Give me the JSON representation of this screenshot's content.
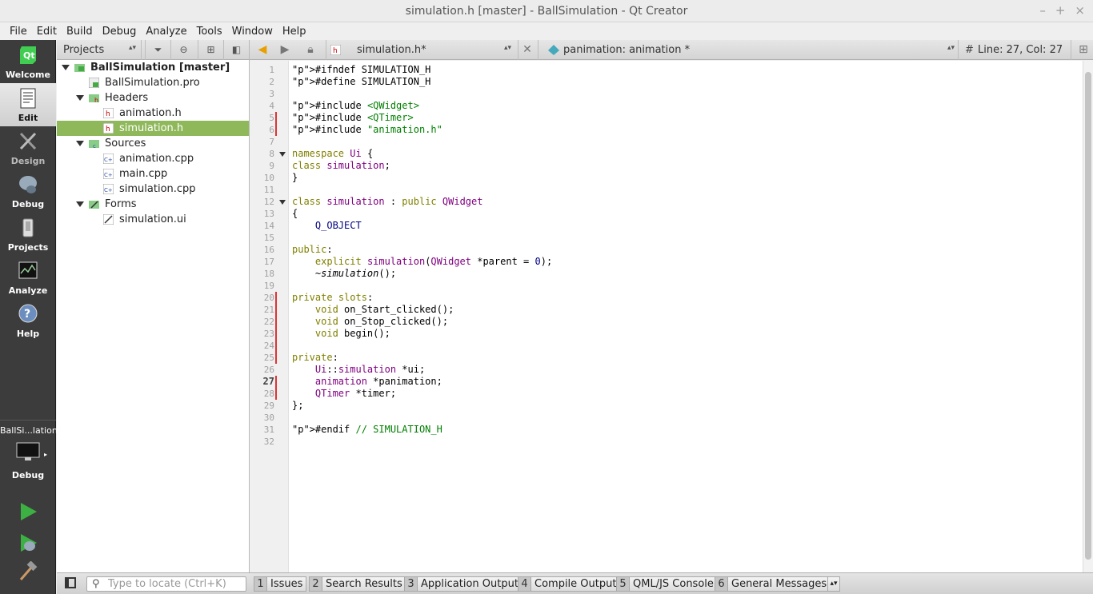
{
  "window": {
    "title": "simulation.h [master] - BallSimulation - Qt Creator",
    "controls": [
      "–",
      "+",
      "×"
    ]
  },
  "menu": [
    "File",
    "Edit",
    "Build",
    "Debug",
    "Analyze",
    "Tools",
    "Window",
    "Help"
  ],
  "modes": [
    {
      "label": "Welcome",
      "icon": "qt-logo-icon"
    },
    {
      "label": "Edit",
      "icon": "edit-document-icon"
    },
    {
      "label": "Design",
      "icon": "design-pen-icon"
    },
    {
      "label": "Debug",
      "icon": "debug-bug-icon"
    },
    {
      "label": "Projects",
      "icon": "projects-wrench-icon"
    },
    {
      "label": "Analyze",
      "icon": "analyze-chart-icon"
    },
    {
      "label": "Help",
      "icon": "help-question-icon"
    }
  ],
  "kit": {
    "name": "BallSi...lation",
    "build": "Debug"
  },
  "project_panel": {
    "combo_label": "Projects"
  },
  "tree": [
    {
      "label": "BallSimulation [master]",
      "bold": true,
      "type": "project"
    },
    {
      "label": "BallSimulation.pro",
      "type": "pro"
    },
    {
      "label": "Headers",
      "type": "folder-h"
    },
    {
      "label": "animation.h",
      "type": "h"
    },
    {
      "label": "simulation.h",
      "type": "h",
      "selected": true
    },
    {
      "label": "Sources",
      "type": "folder-cpp"
    },
    {
      "label": "animation.cpp",
      "type": "cpp"
    },
    {
      "label": "main.cpp",
      "type": "cpp"
    },
    {
      "label": "simulation.cpp",
      "type": "cpp"
    },
    {
      "label": "Forms",
      "type": "folder-ui"
    },
    {
      "label": "simulation.ui",
      "type": "ui"
    }
  ],
  "editor_toolbar": {
    "file": "simulation.h*",
    "symbol": "panimation: animation *",
    "position": "Line: 27, Col: 27"
  },
  "editor": {
    "current_line": 27,
    "changed_lines": [
      5,
      6,
      20,
      21,
      22,
      23,
      24,
      25,
      27,
      28
    ],
    "fold_lines": [
      8,
      12
    ],
    "lines": [
      "#ifndef SIMULATION_H",
      "#define SIMULATION_H",
      "",
      "#include <QWidget>",
      "#include <QTimer>",
      "#include \"animation.h\"",
      "",
      "namespace Ui {",
      "class simulation;",
      "}",
      "",
      "class simulation : public QWidget",
      "{",
      "    Q_OBJECT",
      "",
      "public:",
      "    explicit simulation(QWidget *parent = 0);",
      "    ~simulation();",
      "",
      "private slots:",
      "    void on_Start_clicked();",
      "    void on_Stop_clicked();",
      "    void begin();",
      "",
      "private:",
      "    Ui::simulation *ui;",
      "    animation *panimation;",
      "    QTimer *timer;",
      "};",
      "",
      "#endif // SIMULATION_H",
      ""
    ]
  },
  "statusbar": {
    "locate_placeholder": "Type to locate (Ctrl+K)",
    "tabs": [
      {
        "num": "1",
        "label": "Issues"
      },
      {
        "num": "2",
        "label": "Search Results"
      },
      {
        "num": "3",
        "label": "Application Output"
      },
      {
        "num": "4",
        "label": "Compile Output"
      },
      {
        "num": "5",
        "label": "QML/JS Console"
      },
      {
        "num": "6",
        "label": "General Messages"
      }
    ]
  }
}
